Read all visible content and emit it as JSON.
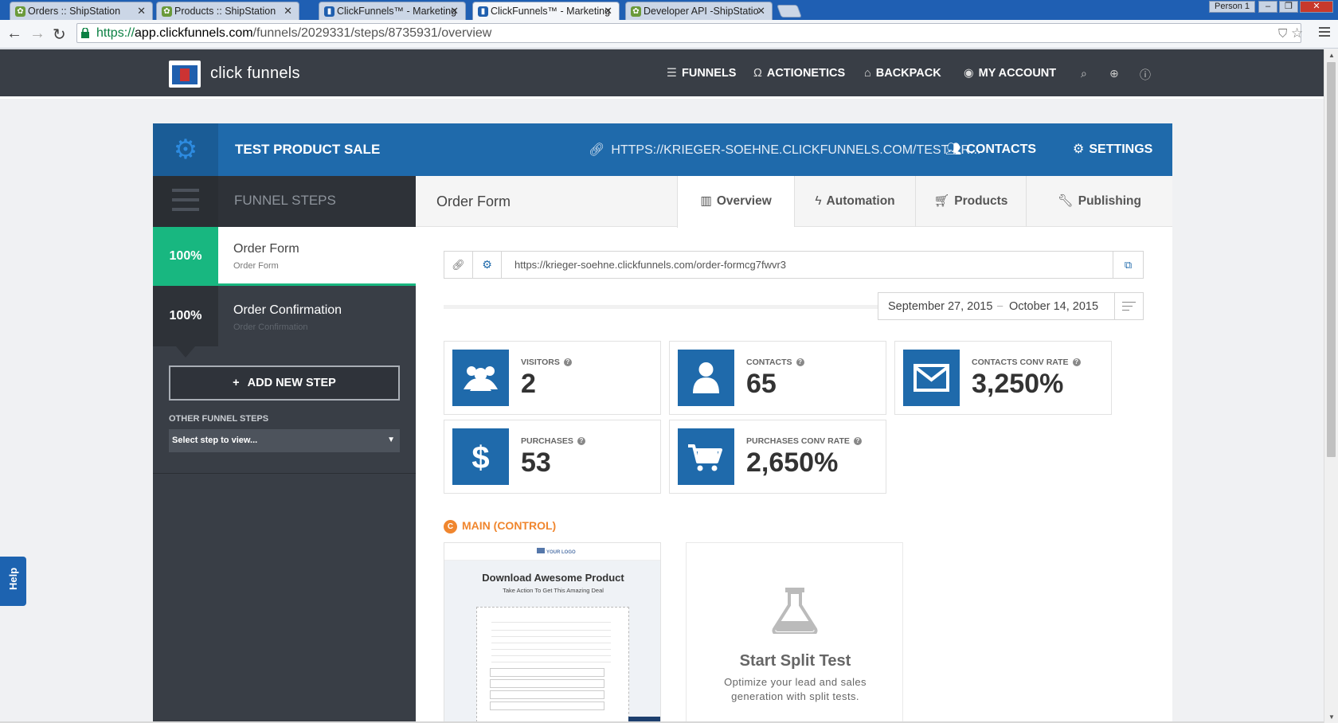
{
  "browser": {
    "tabs": [
      {
        "title": "Orders :: ShipStation"
      },
      {
        "title": "Products :: ShipStation"
      },
      {
        "title": "ClickFunnels™ - Marketing"
      },
      {
        "title": "ClickFunnels™ - Marketing"
      },
      {
        "title": "Developer API -ShipStatio"
      }
    ],
    "profile": "Person 1",
    "url_proto": "https://",
    "url_host": "app.clickfunnels.com",
    "url_path": "/funnels/2029331/steps/8735931/overview"
  },
  "header": {
    "brand": "click funnels",
    "nav": [
      {
        "label": "FUNNELS",
        "icon": "list-icon"
      },
      {
        "label": "ACTIONETICS",
        "icon": "headphones-icon"
      },
      {
        "label": "BACKPACK",
        "icon": "backpack-icon"
      },
      {
        "label": "MY ACCOUNT",
        "icon": "avatar-icon"
      }
    ]
  },
  "funnel": {
    "title": "TEST PRODUCT SALE",
    "url": "HTTPS://KRIEGER-SOEHNE.CLICKFUNNELS.COM/TEST-PR...",
    "contacts_label": "CONTACTS",
    "settings_label": "SETTINGS"
  },
  "sidebar": {
    "heading": "FUNNEL STEPS",
    "steps": [
      {
        "pct": "100%",
        "name": "Order Form",
        "sub": "Order Form"
      },
      {
        "pct": "100%",
        "name": "Order Confirmation",
        "sub": "Order Confirmation"
      }
    ],
    "add_step": "ADD NEW STEP",
    "other_label": "OTHER FUNNEL STEPS",
    "select_placeholder": "Select step to view..."
  },
  "content": {
    "title": "Order Form",
    "tabs": [
      {
        "label": "Overview",
        "icon": "bar-chart-icon"
      },
      {
        "label": "Automation",
        "icon": "bolt-icon"
      },
      {
        "label": "Products",
        "icon": "cart-icon"
      },
      {
        "label": "Publishing",
        "icon": "wrench-icon"
      }
    ],
    "page_url": "https://krieger-soehne.clickfunnels.com/order-formcg7fwvr3",
    "date_from": "September 27, 2015",
    "date_to": "October 14, 2015",
    "stats": [
      {
        "label": "VISITORS",
        "value": "2",
        "icon": "users-icon"
      },
      {
        "label": "CONTACTS",
        "value": "65",
        "icon": "user-icon"
      },
      {
        "label": "CONTACTS CONV RATE",
        "value": "3,250%",
        "icon": "envelope-icon"
      },
      {
        "label": "PURCHASES",
        "value": "53",
        "icon": "dollar-icon"
      },
      {
        "label": "PURCHASES CONV RATE",
        "value": "2,650%",
        "icon": "cart-icon"
      }
    ],
    "variant_label": "MAIN (CONTROL)",
    "variant_badge": "C",
    "preview": {
      "logo": "YOUR LOGO",
      "title": "Download Awesome Product",
      "subtitle": "Take Action To Get This Amazing Deal"
    },
    "split_test": {
      "title": "Start Split Test",
      "desc": "Optimize your lead and sales generation with split tests."
    }
  },
  "help_label": "Help",
  "colors": {
    "brand_blue": "#1f6aab",
    "green": "#18b780",
    "dark": "#393e46",
    "orange": "#f0862e"
  }
}
